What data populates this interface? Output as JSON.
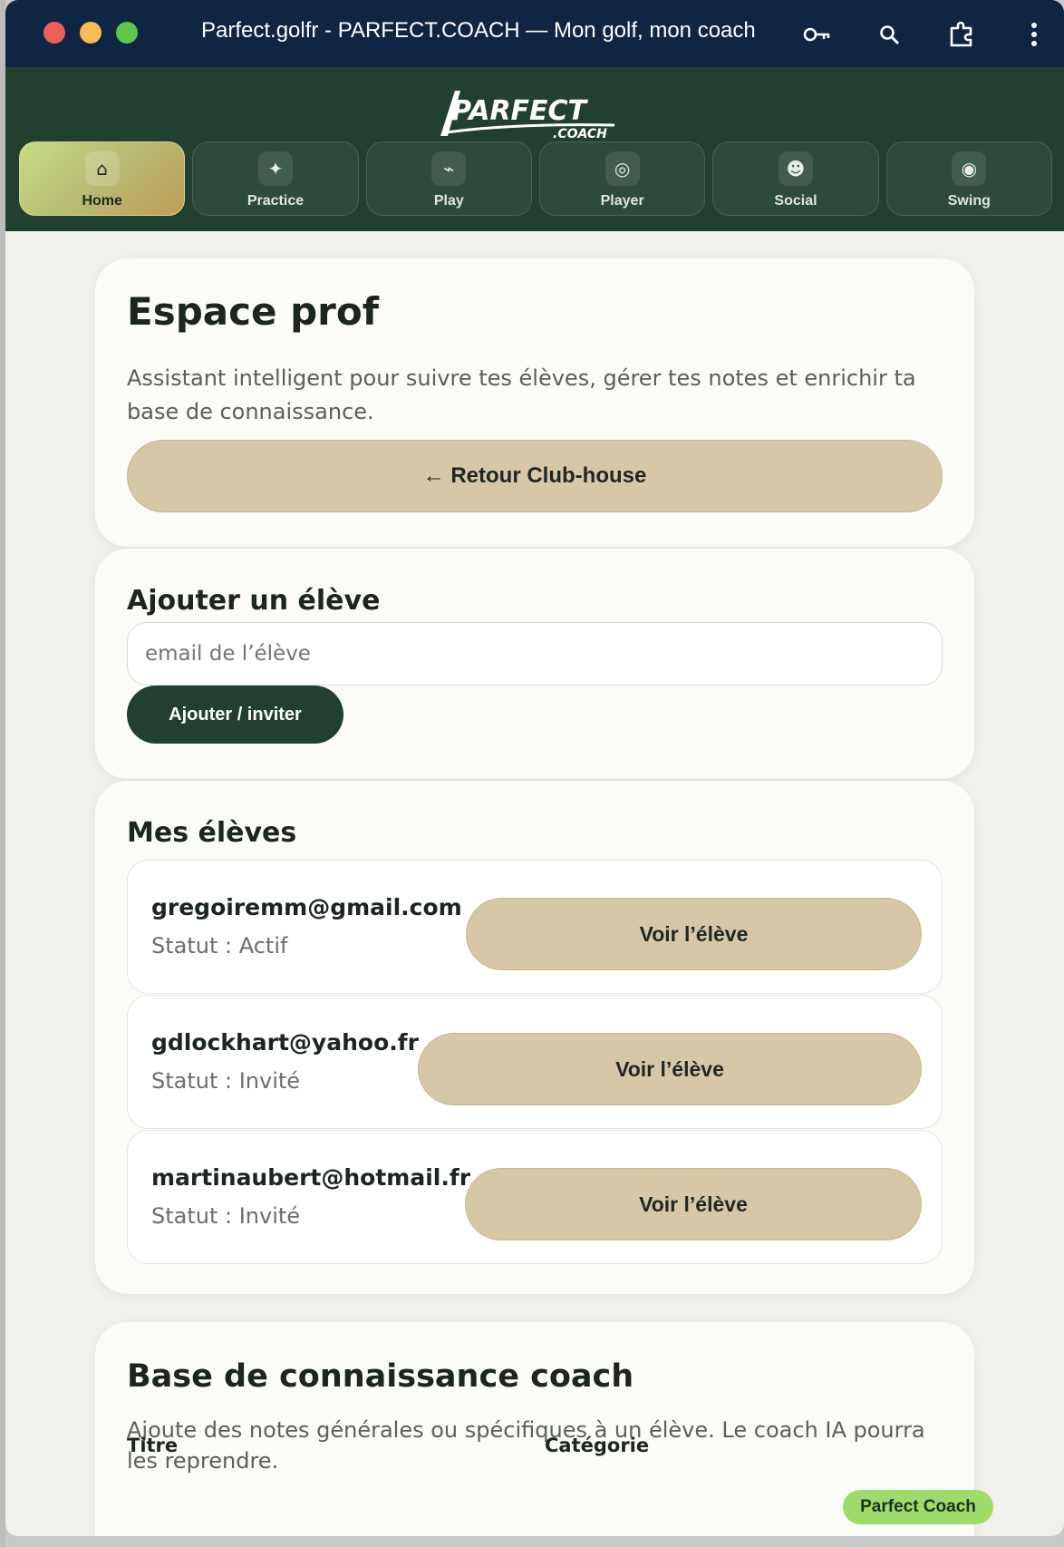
{
  "window": {
    "title": "Parfect.golfr - PARFECT.COACH — Mon golf, mon coach"
  },
  "logo": {
    "main": "PARFECT",
    "sub": ".COACH"
  },
  "nav": {
    "tabs": [
      {
        "label": "Home",
        "icon": "house-icon",
        "glyph": "⌂",
        "active": true
      },
      {
        "label": "Practice",
        "icon": "sparkle-icon",
        "glyph": "✦",
        "active": false
      },
      {
        "label": "Play",
        "icon": "flag-icon",
        "glyph": "⌁",
        "active": false
      },
      {
        "label": "Player",
        "icon": "target-icon",
        "glyph": "◎",
        "active": false
      },
      {
        "label": "Social",
        "icon": "smile-icon",
        "glyph": "☻",
        "active": false
      },
      {
        "label": "Swing",
        "icon": "record-icon",
        "glyph": "◉",
        "active": false
      }
    ]
  },
  "header_card": {
    "title": "Espace prof",
    "description": "Assistant intelligent pour suivre tes élèves, gérer tes notes et enrichir ta base de connaissance.",
    "back_button": "← Retour Club-house"
  },
  "add_student": {
    "title": "Ajouter un élève",
    "email_placeholder": "email de l’élève",
    "email_value": "",
    "submit": "Ajouter / inviter"
  },
  "students": {
    "title": "Mes élèves",
    "items": [
      {
        "email": "gregoiremm@gmail.com",
        "status": "Statut : Actif",
        "action": "Voir l’élève"
      },
      {
        "email": "gdlockhart@yahoo.fr",
        "status": "Statut : Invité",
        "action": "Voir l’élève"
      },
      {
        "email": "martinaubert@hotmail.fr",
        "status": "Statut : Invité",
        "action": "Voir l’élève"
      }
    ]
  },
  "knowledge": {
    "title": "Base de connaissance coach",
    "description": "Ajoute des notes générales ou spécifiques à un élève. Le coach IA pourra les reprendre.",
    "field_title": "Titre",
    "field_category": "Catégorie"
  },
  "floating_badge": "Parfect Coach",
  "colors": {
    "titlebar": "#0f2544",
    "nav_bg": "#22402f",
    "tan_button": "#d6c7a6",
    "dark_button": "#22402f",
    "badge": "#9fdb6b"
  }
}
